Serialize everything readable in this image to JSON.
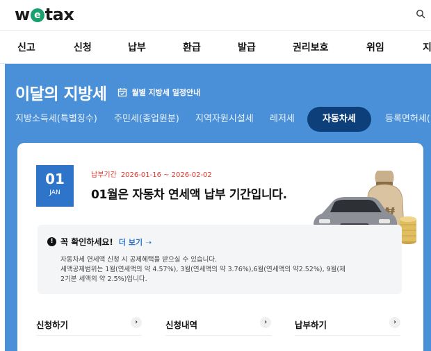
{
  "header": {
    "logo_w": "w",
    "logo_e": "e",
    "logo_rest": "tax",
    "search_icon": "search-icon"
  },
  "nav": {
    "items": [
      "신고",
      "신청",
      "납부",
      "환급",
      "발급",
      "권리보호",
      "위임",
      "지"
    ]
  },
  "main": {
    "title": "이달의 지방세",
    "schedule_link": "월별 지방세 일정안내",
    "tabs": [
      "지방소득세(특별징수)",
      "주민세(종업원분)",
      "지역자원시설세",
      "레저세",
      "자동차세",
      "등록면허세("
    ],
    "active_tab": "자동차세"
  },
  "card": {
    "day": "01",
    "month": "JAN",
    "period_label": "납부기간",
    "period_value": "2026-01-16 ~ 2026-02-02",
    "headline": "01월은 자동차 연세액 납부 기간입니다.",
    "notice": {
      "title": "꼭 확인하세요!",
      "more": "더 보기",
      "line1": "자동차세 연세액 신청 시 공제혜택을 받으실 수 있습니다.",
      "line2": "세액공제범위는 1월(연세액의 약 4.57%), 3월(연세액의 약 3.76%),6월(연세액의 약2.52%), 9월(제",
      "line3": "2기분 세액의 약 2.5%)입니다."
    },
    "actions": [
      "신청하기",
      "신청내역",
      "납부하기"
    ]
  },
  "colors": {
    "brand_green": "#1aa06f",
    "blue_bg": "#4a90d9",
    "active_tab": "#0d3f7a",
    "date_box": "#2e74c9",
    "period_red": "#e5332a"
  }
}
